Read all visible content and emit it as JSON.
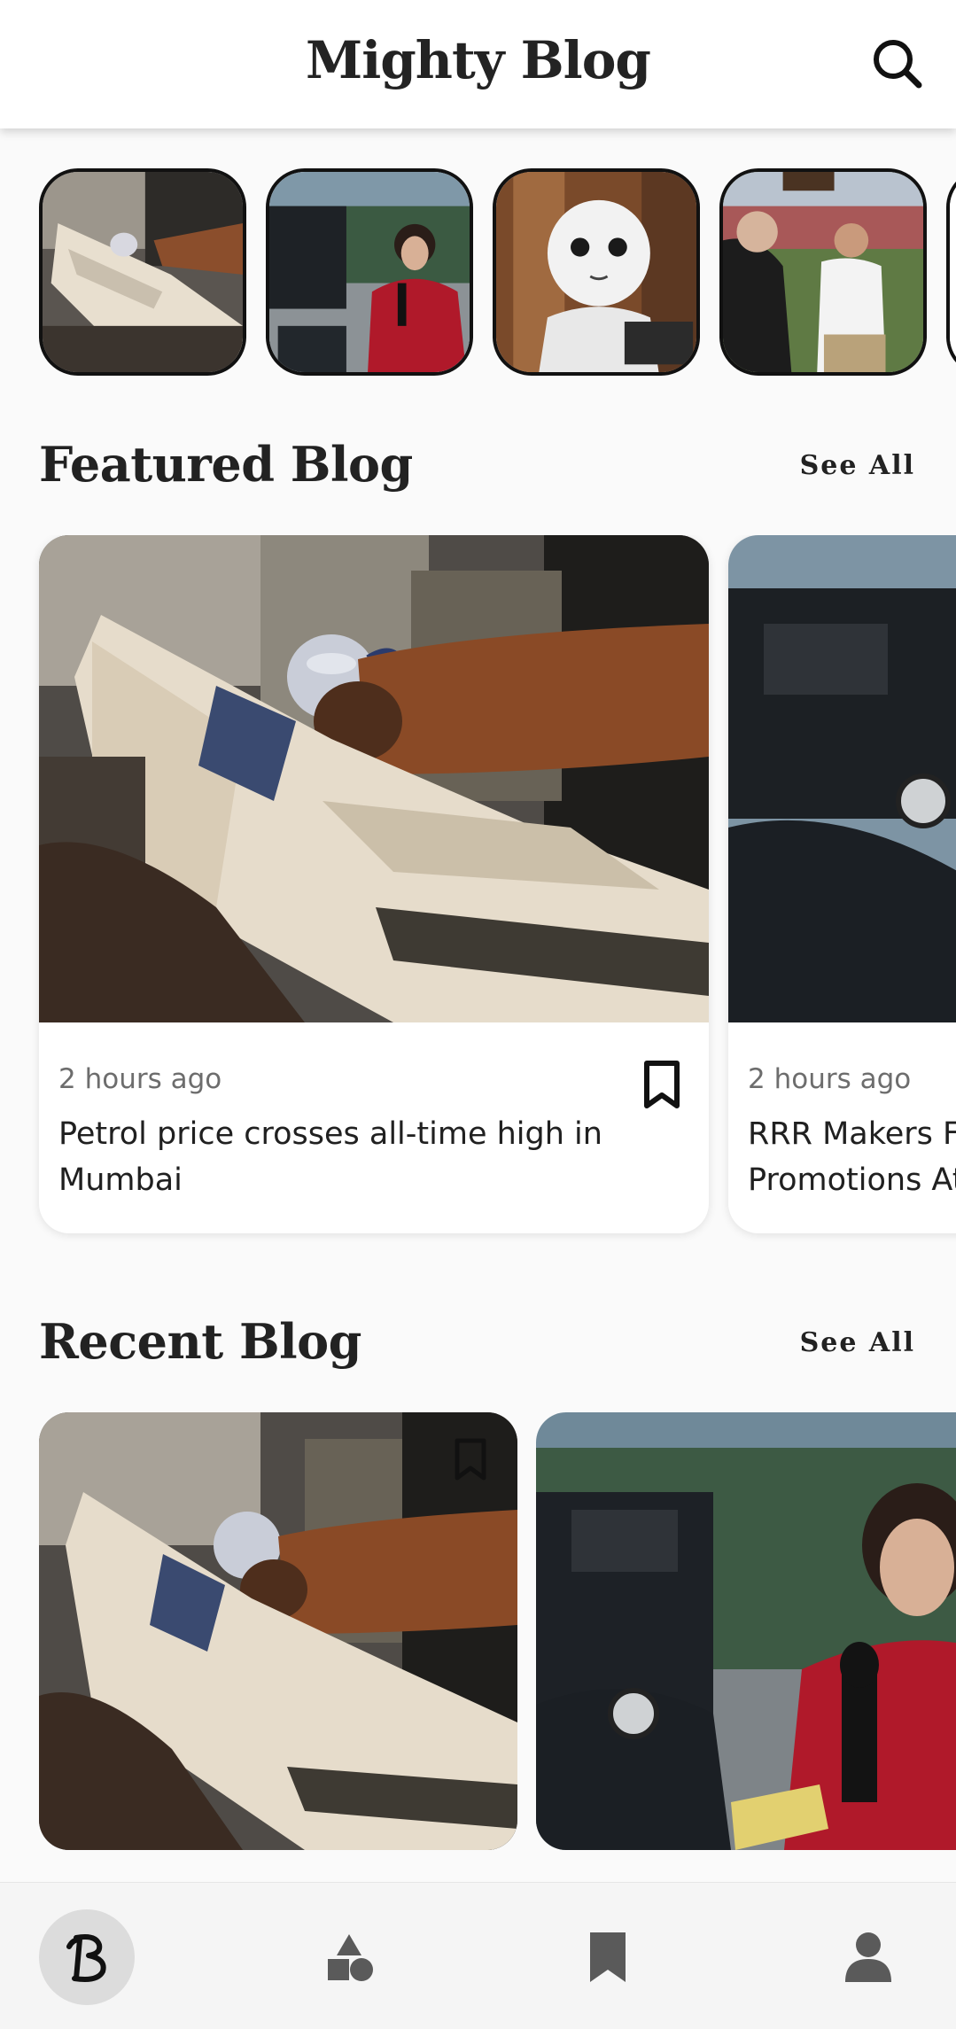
{
  "header": {
    "title": "Mighty Blog",
    "search_icon": "search-icon"
  },
  "stories": [
    {
      "name": "story-newspaper",
      "scene": "newspaper"
    },
    {
      "name": "story-reporter",
      "scene": "reporter"
    },
    {
      "name": "story-robot",
      "scene": "robot"
    },
    {
      "name": "story-handshake",
      "scene": "handshake"
    }
  ],
  "featured": {
    "title": "Featured Blog",
    "see_all": "See All",
    "cards": [
      {
        "time": "2 hours ago",
        "headline_line1": "Petrol price crosses all-time high in",
        "headline_line2": "Mumbai"
      },
      {
        "time": "2 hours ago",
        "headline_line1": "RRR Makers Fo",
        "headline_line2": "Promotions At"
      }
    ]
  },
  "recent": {
    "title": "Recent Blog",
    "see_all": "See All"
  },
  "bottom_nav": {
    "items": [
      {
        "name": "nav-home",
        "icon": "blog-logo-icon"
      },
      {
        "name": "nav-categories",
        "icon": "shapes-icon"
      },
      {
        "name": "nav-bookmarks",
        "icon": "bookmark-icon"
      },
      {
        "name": "nav-profile",
        "icon": "person-icon"
      }
    ]
  },
  "colors": {
    "accent": "#232323",
    "background": "#fafafa",
    "nav_active_bg": "#dcdcdc"
  }
}
